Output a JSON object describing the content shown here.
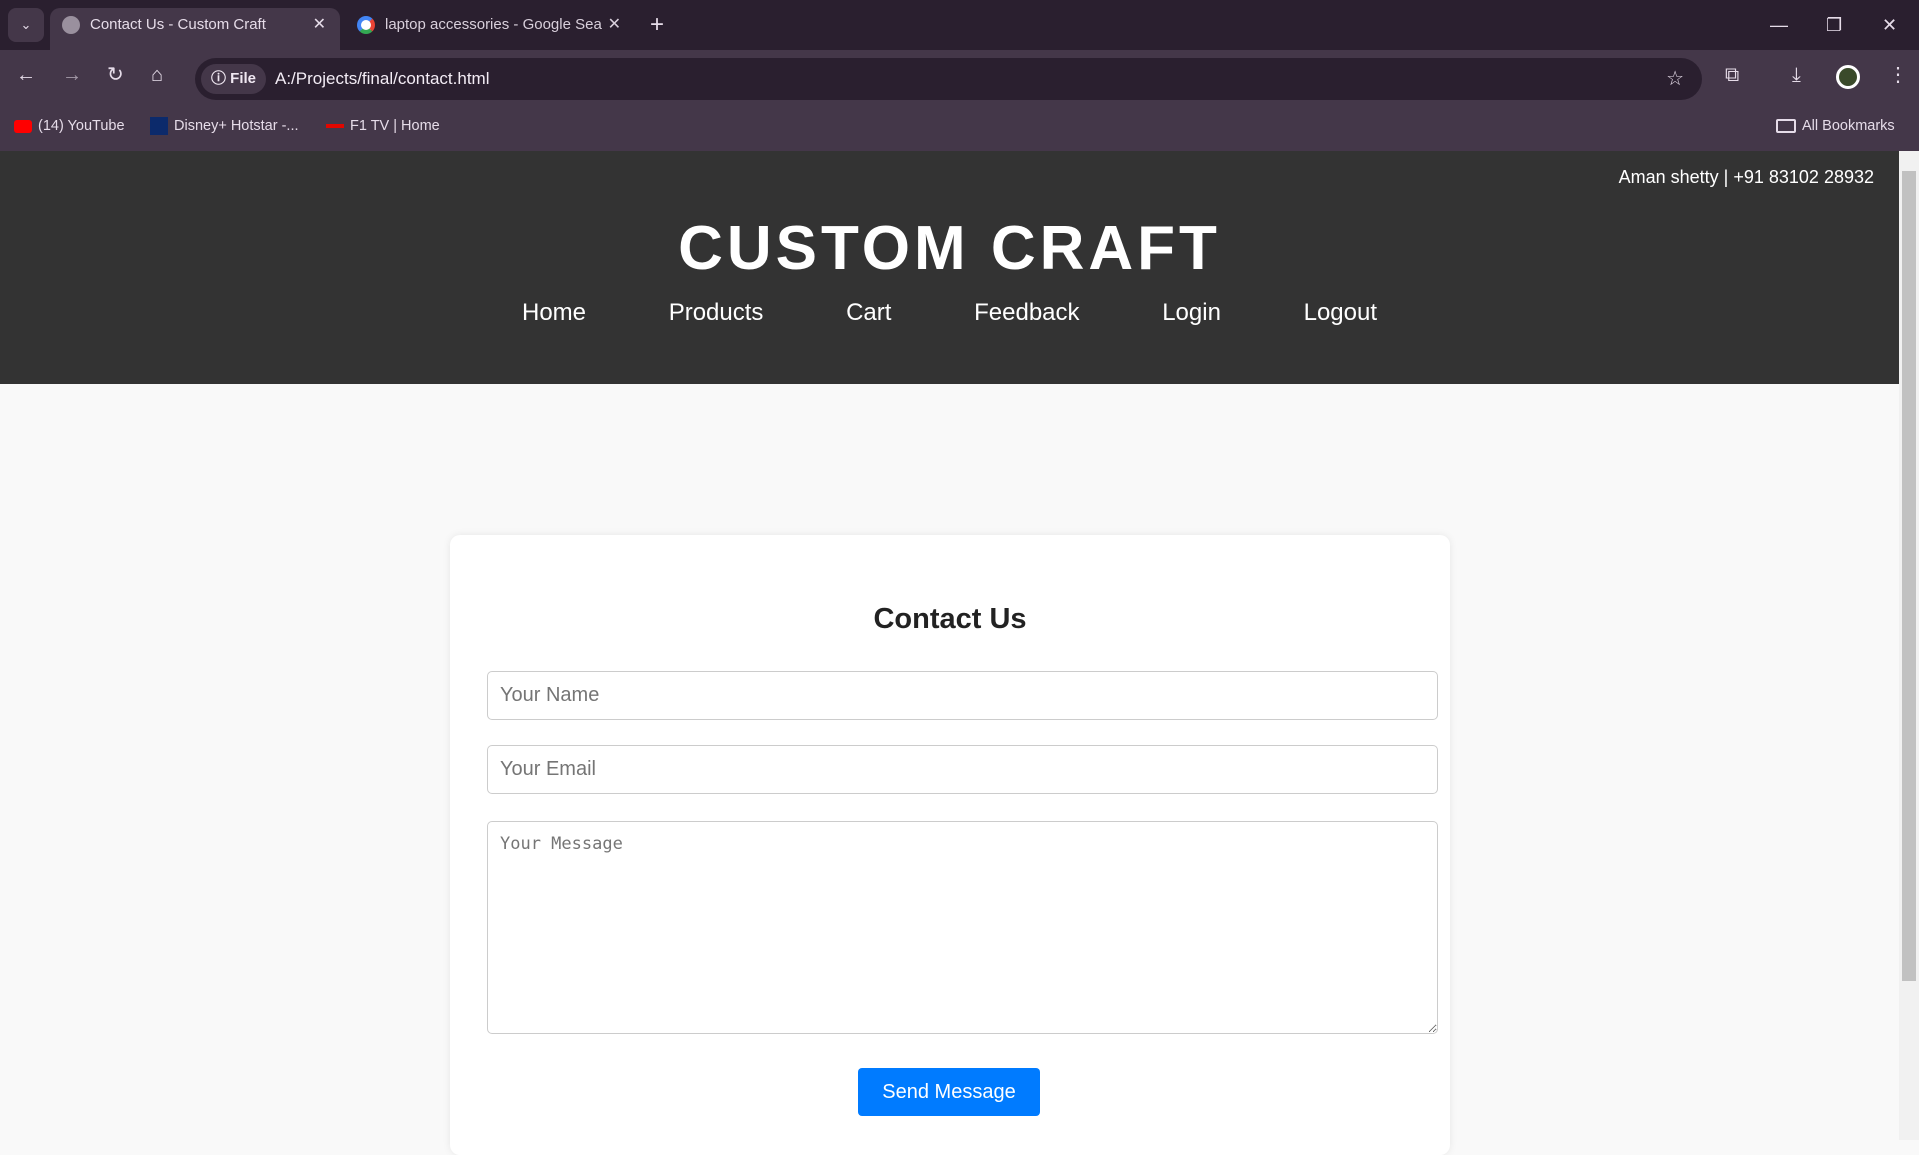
{
  "browser": {
    "tabs": [
      {
        "title": "Contact Us - Custom Craft",
        "active": true
      },
      {
        "title": "laptop accessories - Google Sea",
        "active": false
      }
    ],
    "url_chip": "File",
    "url": "A:/Projects/final/contact.html",
    "bookmarks": [
      {
        "label": "(14) YouTube"
      },
      {
        "label": "Disney+ Hotstar -..."
      },
      {
        "label": "F1 TV | Home"
      }
    ],
    "all_bookmarks": "All Bookmarks"
  },
  "header": {
    "contact": "Aman shetty | +91 83102 28932",
    "title": "CUSTOM CRAFT",
    "nav": [
      "Home",
      "Products",
      "Cart",
      "Feedback",
      "Login",
      "Logout"
    ]
  },
  "form": {
    "heading": "Contact Us",
    "name_placeholder": "Your Name",
    "email_placeholder": "Your Email",
    "message_placeholder": "Your Message",
    "submit": "Send Message"
  },
  "colors": {
    "header_bg": "#333333",
    "button": "#007bff",
    "chrome": "#443749"
  }
}
